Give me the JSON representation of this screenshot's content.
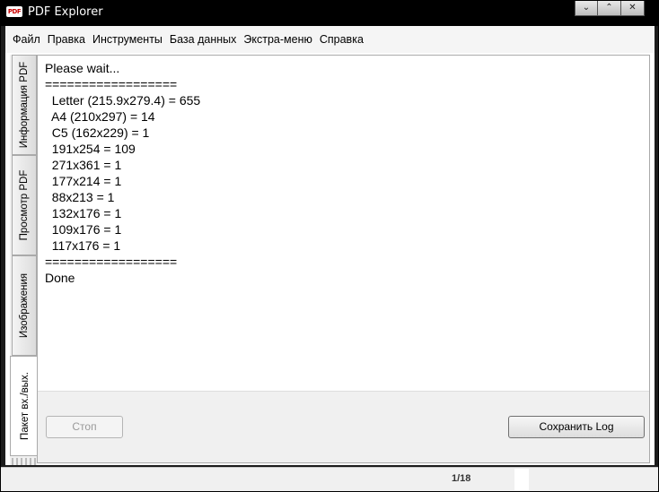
{
  "window": {
    "title": "PDF Explorer",
    "icon_text": "PDF"
  },
  "menu": [
    "Файл",
    "Правка",
    "Инструменты",
    "База данных",
    "Экстра-меню",
    "Справка"
  ],
  "tabs": [
    {
      "label": "Информация PDF",
      "active": false
    },
    {
      "label": "Просмотр PDF",
      "active": false
    },
    {
      "label": "Изображения",
      "active": false
    },
    {
      "label": "Пакет вх./вых.",
      "active": true
    }
  ],
  "log": [
    "Please wait...",
    "==================",
    "  Letter (215.9x279.4) = 655",
    "  A4 (210x297) = 14",
    "  C5 (162x229) = 1",
    "  191x254 = 109",
    "  271x361 = 1",
    "  177x214 = 1",
    "  88x213 = 1",
    "  132x176 = 1",
    "  109x176 = 1",
    "  117x176 = 1",
    "==================",
    "Done"
  ],
  "buttons": {
    "stop": "Стоп",
    "save_log": "Сохранить Log"
  },
  "status": {
    "page": "1/18"
  }
}
